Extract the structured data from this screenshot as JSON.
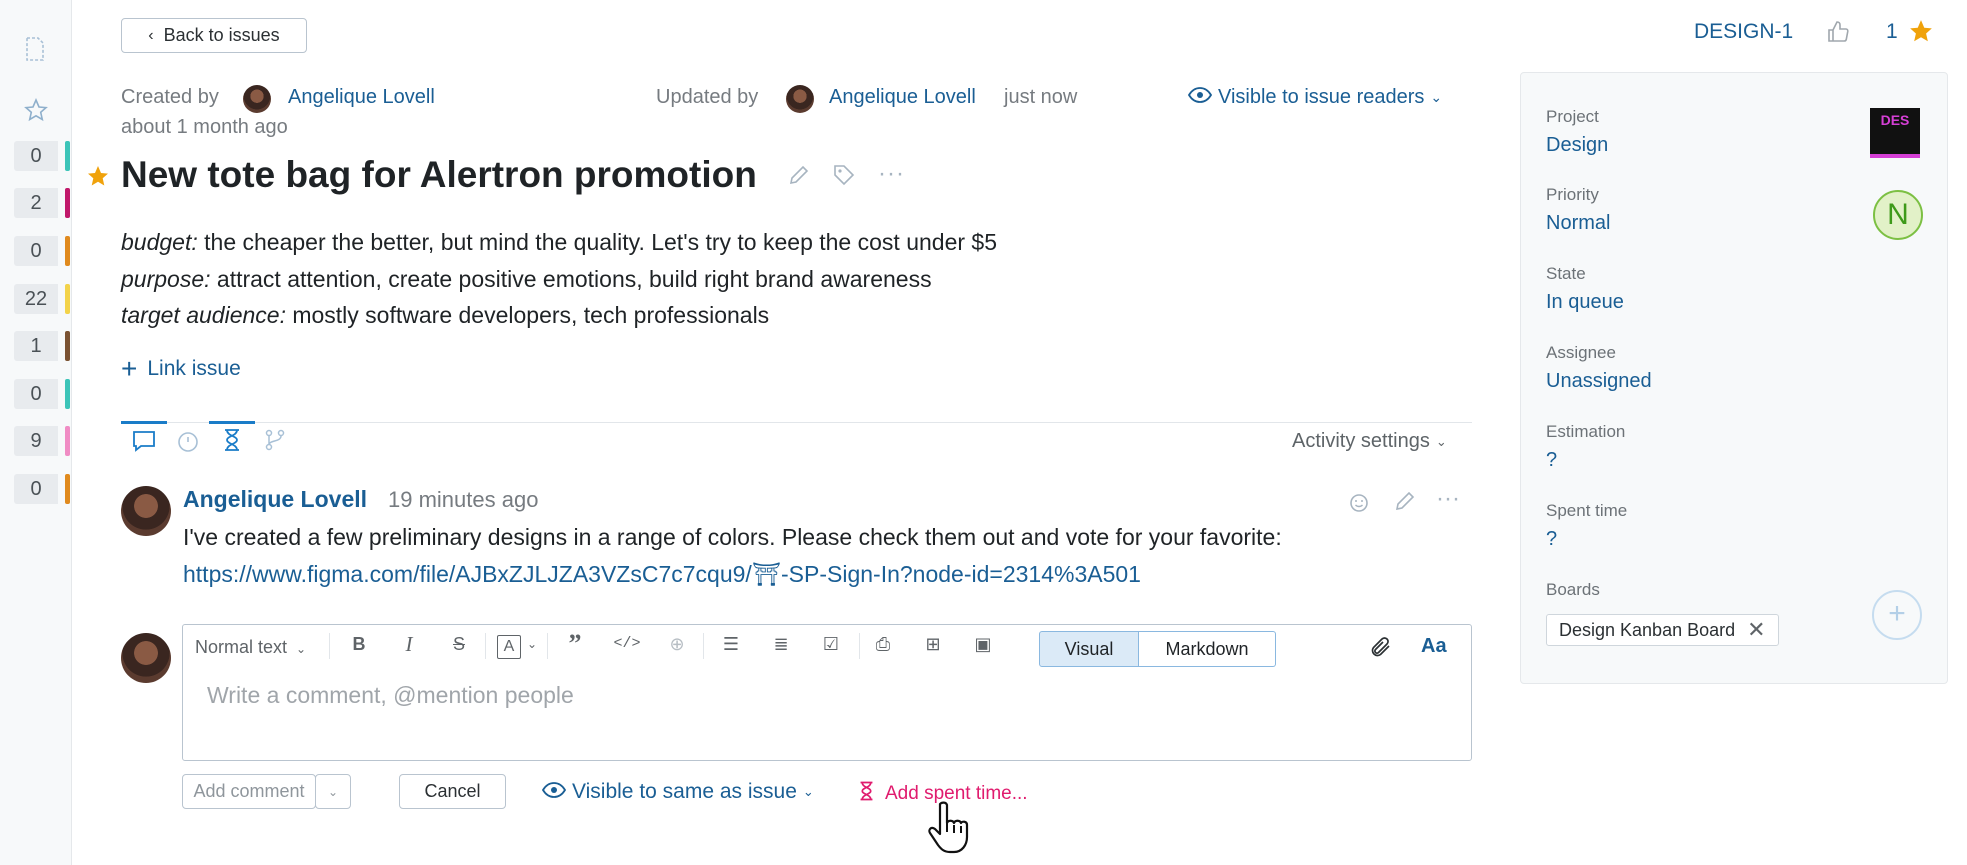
{
  "rail": {
    "counters": [
      {
        "value": "0",
        "color": "#3cc4b8"
      },
      {
        "value": "2",
        "color": "#c0186a"
      },
      {
        "value": "0",
        "color": "#e08a1e"
      },
      {
        "value": "22",
        "color": "#f3d34a"
      },
      {
        "value": "1",
        "color": "#7a5232"
      },
      {
        "value": "0",
        "color": "#3cc4b8"
      },
      {
        "value": "9",
        "color": "#f08cc4"
      },
      {
        "value": "0",
        "color": "#e08a1e"
      }
    ]
  },
  "header": {
    "back_label": "Back to issues",
    "issue_id": "DESIGN-1",
    "star_count": "1"
  },
  "meta": {
    "created_label": "Created by",
    "created_user": "Angelique Lovell",
    "created_time": "about 1 month ago",
    "updated_label": "Updated by",
    "updated_user": "Angelique Lovell",
    "updated_time": "just now",
    "visibility": "Visible to issue readers"
  },
  "issue": {
    "title": "New tote bag for Alertron promotion",
    "desc": [
      {
        "key": "budget:",
        "text": " the cheaper the better, but mind the quality. Let's try to keep the cost under $5"
      },
      {
        "key": "purpose:",
        "text": " attract attention, create positive emotions, build right brand awareness"
      },
      {
        "key": "target audience:",
        "text": " mostly software developers, tech professionals"
      }
    ],
    "link_issue": "Link issue"
  },
  "activity": {
    "settings": "Activity settings"
  },
  "comment": {
    "author": "Angelique Lovell",
    "time": "19 minutes ago",
    "text": "I've created a few preliminary designs in a range of colors. Please check them out and vote for your favorite:",
    "link": "https://www.figma.com/file/AJBxZJLJZA3VZsC7c7cqu9/⛩-SP-Sign-In?node-id=2314%3A501"
  },
  "editor": {
    "text_style": "Normal text",
    "mode_visual": "Visual",
    "mode_markdown": "Markdown",
    "placeholder": "Write a comment, @mention people",
    "add_comment": "Add comment",
    "cancel": "Cancel",
    "visibility": "Visible to same as issue",
    "spent_time": "Add spent time..."
  },
  "sidebar": {
    "fields": [
      {
        "label": "Project",
        "value": "Design"
      },
      {
        "label": "Priority",
        "value": "Normal"
      },
      {
        "label": "State",
        "value": "In queue"
      },
      {
        "label": "Assignee",
        "value": "Unassigned"
      },
      {
        "label": "Estimation",
        "value": "?"
      },
      {
        "label": "Spent time",
        "value": "?"
      },
      {
        "label": "Boards",
        "value": ""
      }
    ],
    "project_badge": "DES",
    "priority_badge": "N",
    "board_tag": "Design Kanban Board"
  }
}
